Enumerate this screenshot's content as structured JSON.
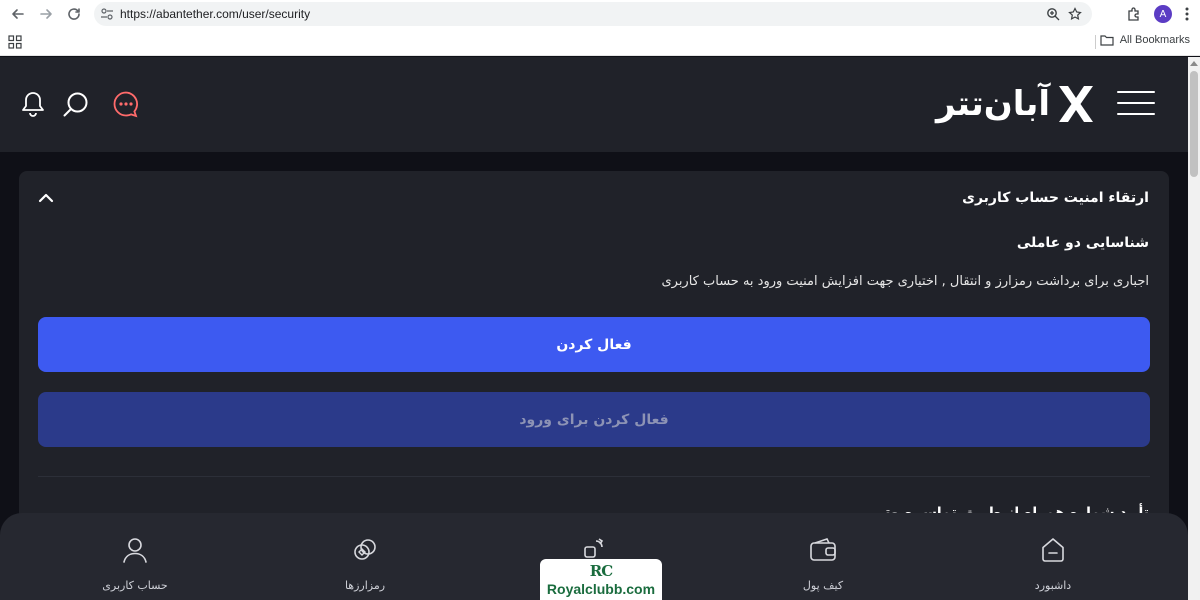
{
  "browser": {
    "url": "https://abantether.com/user/security",
    "profile_initial": "A",
    "all_bookmarks_label": "All Bookmarks"
  },
  "header": {
    "logo_text": "آبان‌تتر"
  },
  "card": {
    "title": "ارتقاء امنیت حساب کاربری",
    "section_title": "شناسایی دو عاملی",
    "section_desc": "اجباری برای برداشت رمزارز و انتقال , اختیاری جهت افزایش امنیت ورود به حساب کاربری",
    "activate_button": "فعال کردن",
    "activate_login_button": "فعال کردن برای ورود",
    "next_section_partial": "تأیید شماره همراه از طریق تماس صوتی"
  },
  "bottom_nav": {
    "items": [
      {
        "label": "داشبورد",
        "icon": "home-icon"
      },
      {
        "label": "کیف پول",
        "icon": "wallet-icon"
      },
      {
        "label": "",
        "icon": "exchange-icon"
      },
      {
        "label": "رمزارزها",
        "icon": "coins-icon"
      },
      {
        "label": "حساب کاربری",
        "icon": "user-icon"
      }
    ]
  },
  "watermark": {
    "logo": "RC",
    "text": "Royalclubb.com"
  },
  "colors": {
    "page_bg": "#0f1017",
    "header_bg": "#202229",
    "card_bg": "#202229",
    "primary_button": "#3d5af1",
    "secondary_button": "#2b3a8a",
    "chat_icon": "#ff6b6b"
  }
}
